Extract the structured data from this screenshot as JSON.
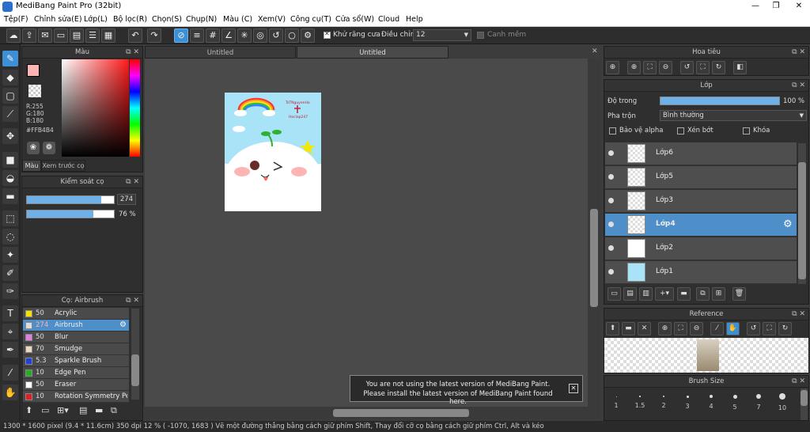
{
  "window": {
    "title": "MediBang Paint Pro (32bit)",
    "min": "—",
    "restore": "❐",
    "close": "✕"
  },
  "menu": [
    "Tệp(F)",
    "Chỉnh sửa(E)",
    "Lớp(L)",
    "Bộ lọc(R)",
    "Chọn(S)",
    "Chụp(N)",
    "Màu (C)",
    "Xem(V)",
    "Công cụ(T)",
    "Cửa sổ(W)",
    "Cloud",
    "Help"
  ],
  "toolbar": {
    "antialias_label": "Khử răng cưa",
    "adjust_label": "Điều chỉnh",
    "adjust_value": "12",
    "snap_label": "Canh mềm"
  },
  "color_panel": {
    "title": "Màu",
    "r": "R:255",
    "g": "G:180",
    "b": "B:180",
    "hex": "#FFB4B4",
    "tab1": "Màu",
    "tab2": "Xem trước cọ",
    "primary": "#ffb4b4"
  },
  "brush_control": {
    "title": "Kiểm soát cọ",
    "size": "274",
    "opacity": "76 %",
    "size_frac": 0.85,
    "opacity_frac": 0.76
  },
  "brush_panel": {
    "title": "Cọ: Airbrush",
    "items": [
      {
        "value": "50",
        "name": "Acrylic",
        "color": "#f5e000"
      },
      {
        "value": "274",
        "name": "Airbrush",
        "color": "#dddddd",
        "active": true
      },
      {
        "value": "50",
        "name": "Blur",
        "color": "#e080e0"
      },
      {
        "value": "70",
        "name": "Smudge",
        "color": "#f0d8c0"
      },
      {
        "value": "5.3",
        "name": "Sparkle Brush",
        "color": "#2040e0"
      },
      {
        "value": "10",
        "name": "Edge Pen",
        "color": "#20b020"
      },
      {
        "value": "50",
        "name": "Eraser",
        "color": "#ffffff"
      },
      {
        "value": "10",
        "name": "Rotation Symmetry Pen",
        "color": "#e02020"
      }
    ]
  },
  "tabs": [
    "Untitled",
    "Untitled"
  ],
  "artwork": {
    "caption_top": "TsTNguyenHo",
    "caption_bot": "Hoclap247"
  },
  "notice": {
    "line1": "You are not using the latest version of MediBang Paint.",
    "line2": "Please install the latest version of MediBang Paint found here."
  },
  "navigator": {
    "title": "Hoa tiêu"
  },
  "layer_panel": {
    "title": "Lớp",
    "opacity_label": "Độ trong",
    "opacity_value": "100 %",
    "blend_label": "Pha trộn",
    "blend_value": "Bình thường",
    "protect_alpha": "Bảo vệ alpha",
    "clip": "Xén bớt",
    "lock": "Khóa",
    "layers": [
      {
        "name": "Lớp6"
      },
      {
        "name": "Lớp5"
      },
      {
        "name": "Lớp3"
      },
      {
        "name": "Lớp4",
        "active": true
      },
      {
        "name": "Lớp2"
      },
      {
        "name": "Lớp1"
      }
    ]
  },
  "reference": {
    "title": "Reference"
  },
  "brush_size": {
    "title": "Brush Size",
    "sizes": [
      "1",
      "1.5",
      "2",
      "3",
      "4",
      "5",
      "7",
      "10"
    ]
  },
  "status": {
    "text": "1300 * 1600 pixel   (9.4 * 11.6cm)   350 dpi   12 %   ( -1070, 1683 )   Vẽ một đường thẳng bằng cách giữ phím Shift, Thay đổi cỡ cọ bằng cách giữ phím Ctrl, Alt và kéo"
  }
}
